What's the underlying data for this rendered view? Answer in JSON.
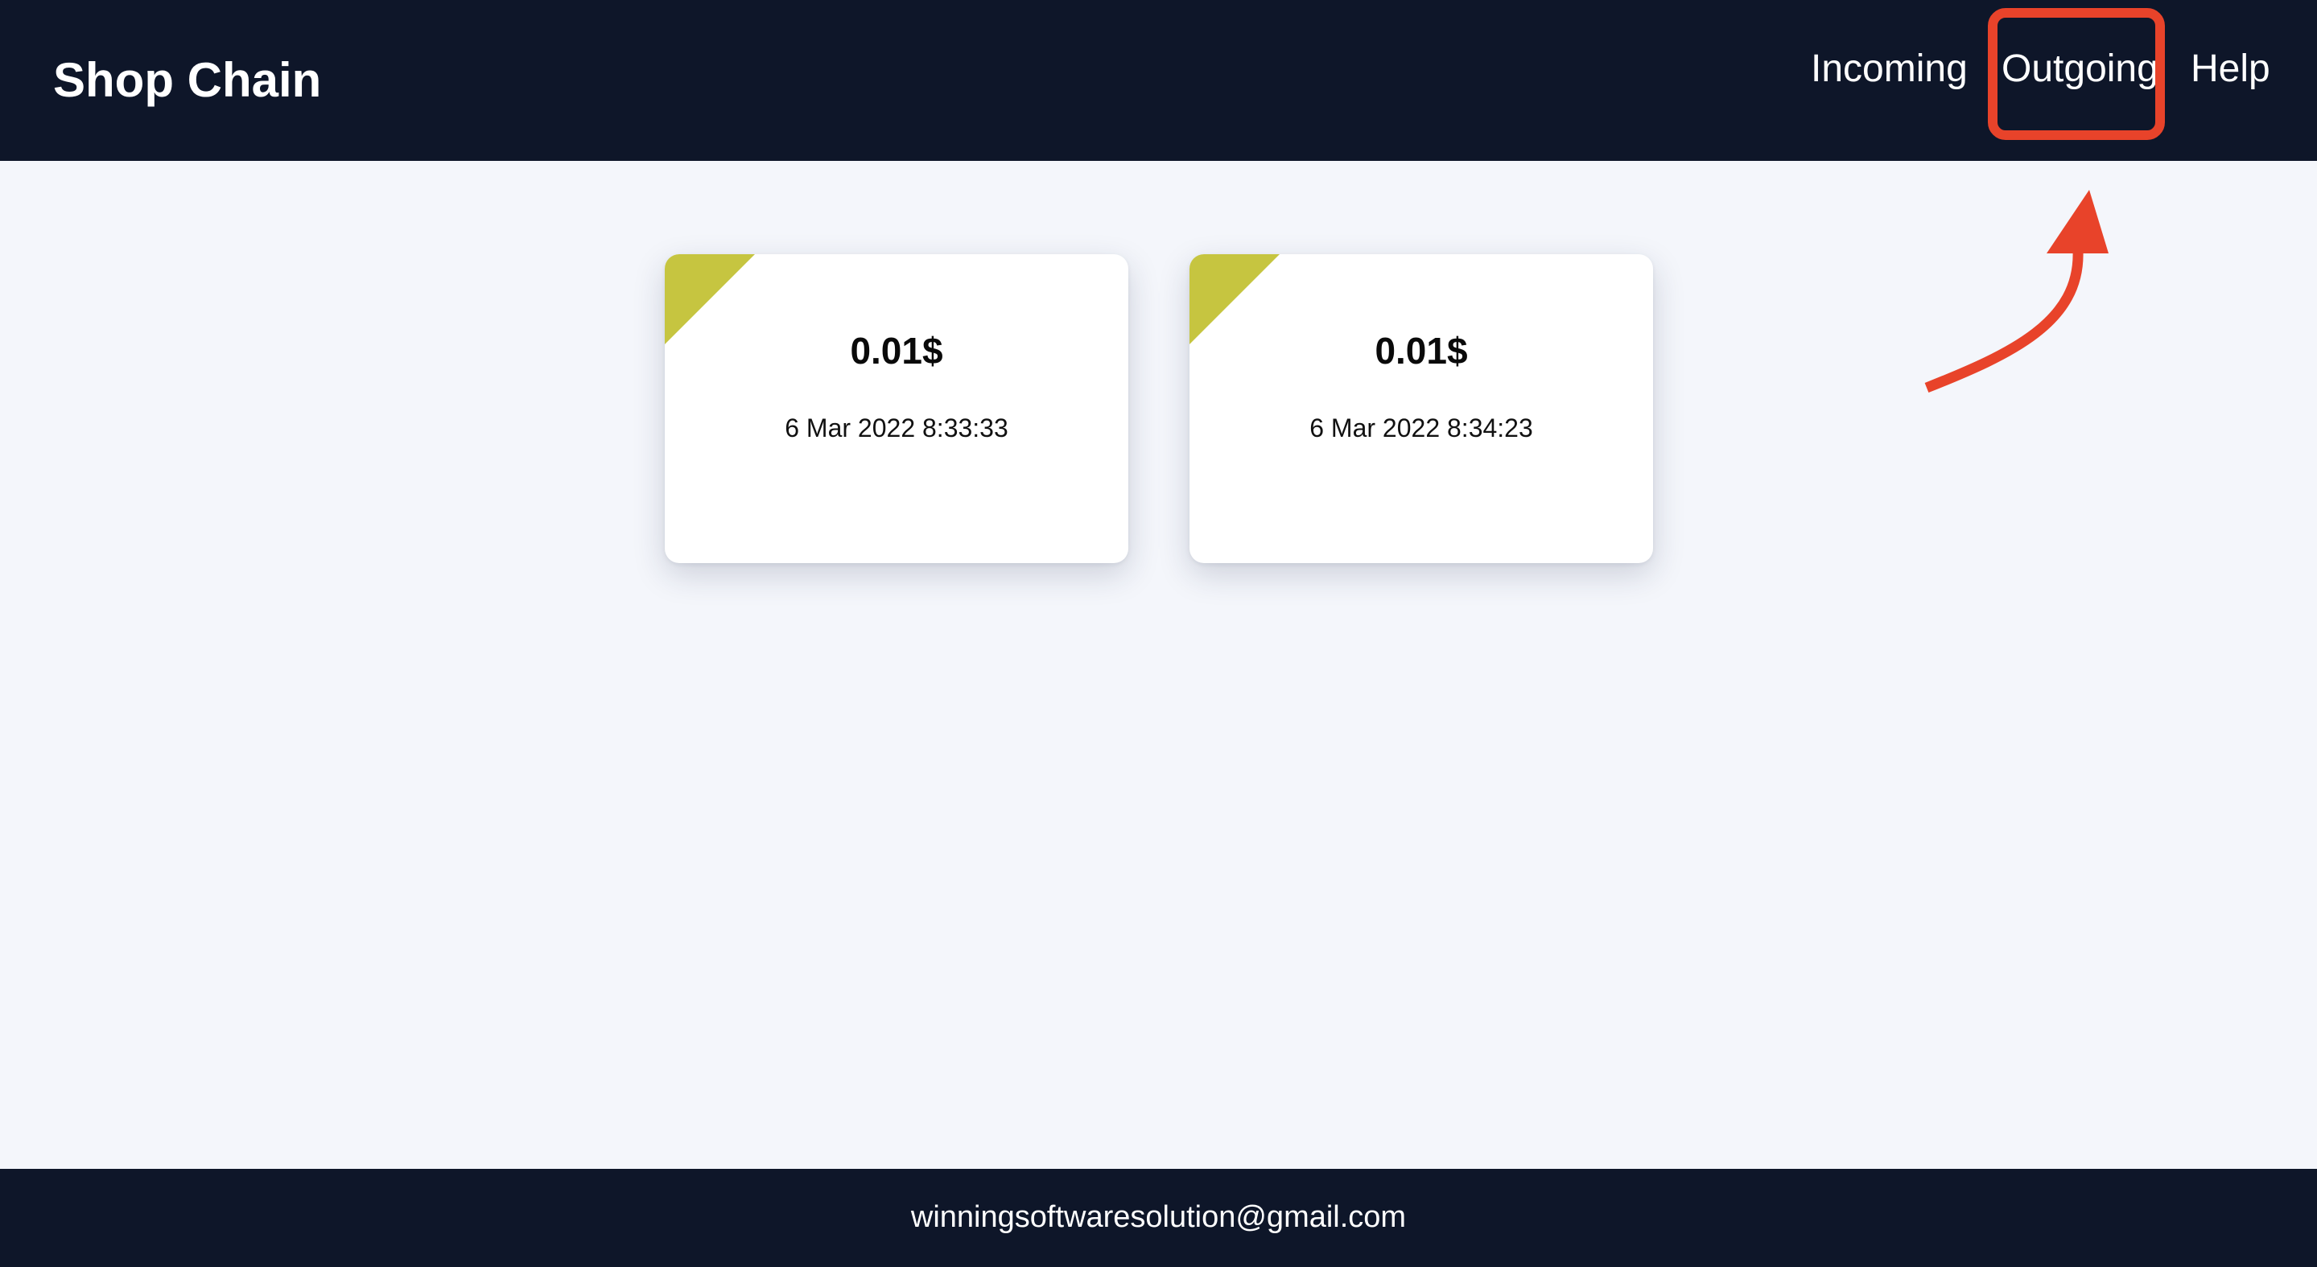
{
  "header": {
    "brand": "Shop Chain",
    "nav": {
      "incoming": "Incoming",
      "outgoing": "Outgoing",
      "help": "Help"
    }
  },
  "annotation": {
    "highlighted_item": "Outgoing",
    "color": "#e8432a"
  },
  "transactions": [
    {
      "amount": "0.01$",
      "date": "6 Mar 2022 8:33:33"
    },
    {
      "amount": "0.01$",
      "date": "6 Mar 2022 8:34:23"
    }
  ],
  "footer": {
    "email": "winningsoftwaresolution@gmail.com"
  },
  "colors": {
    "nav_background": "#0e1629",
    "page_background": "#f4f6fb",
    "card_corner_accent": "#c6c540",
    "text_light": "#ffffff"
  }
}
